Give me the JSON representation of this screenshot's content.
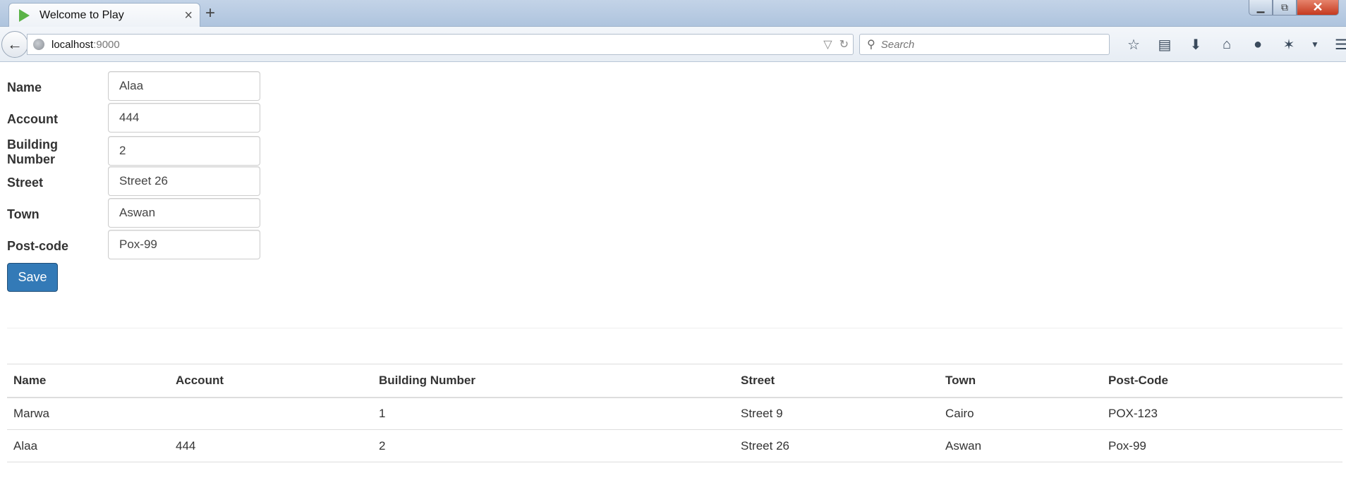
{
  "browser": {
    "tab_title": "Welcome to Play",
    "tab_close": "×",
    "new_tab": "+",
    "url_host": "localhost",
    "url_port": ":9000",
    "search_placeholder": "Search"
  },
  "form": {
    "fields": [
      {
        "label": "Name",
        "value": "Alaa"
      },
      {
        "label": "Account",
        "value": "444"
      },
      {
        "label": "Building Number",
        "value": "2"
      },
      {
        "label": "Street",
        "value": "Street 26"
      },
      {
        "label": "Town",
        "value": "Aswan"
      },
      {
        "label": "Post-code",
        "value": "Pox-99"
      }
    ],
    "save_label": "Save"
  },
  "table": {
    "headers": [
      "Name",
      "Account",
      "Building Number",
      "Street",
      "Town",
      "Post-Code"
    ],
    "rows": [
      [
        "Marwa",
        "",
        "1",
        "Street 9",
        "Cairo",
        "POX-123"
      ],
      [
        "Alaa",
        "444",
        "2",
        "Street 26",
        "Aswan",
        "Pox-99"
      ]
    ]
  },
  "colors": {
    "primary_button": "#337ab7",
    "tab_icon": "#5ab347"
  }
}
